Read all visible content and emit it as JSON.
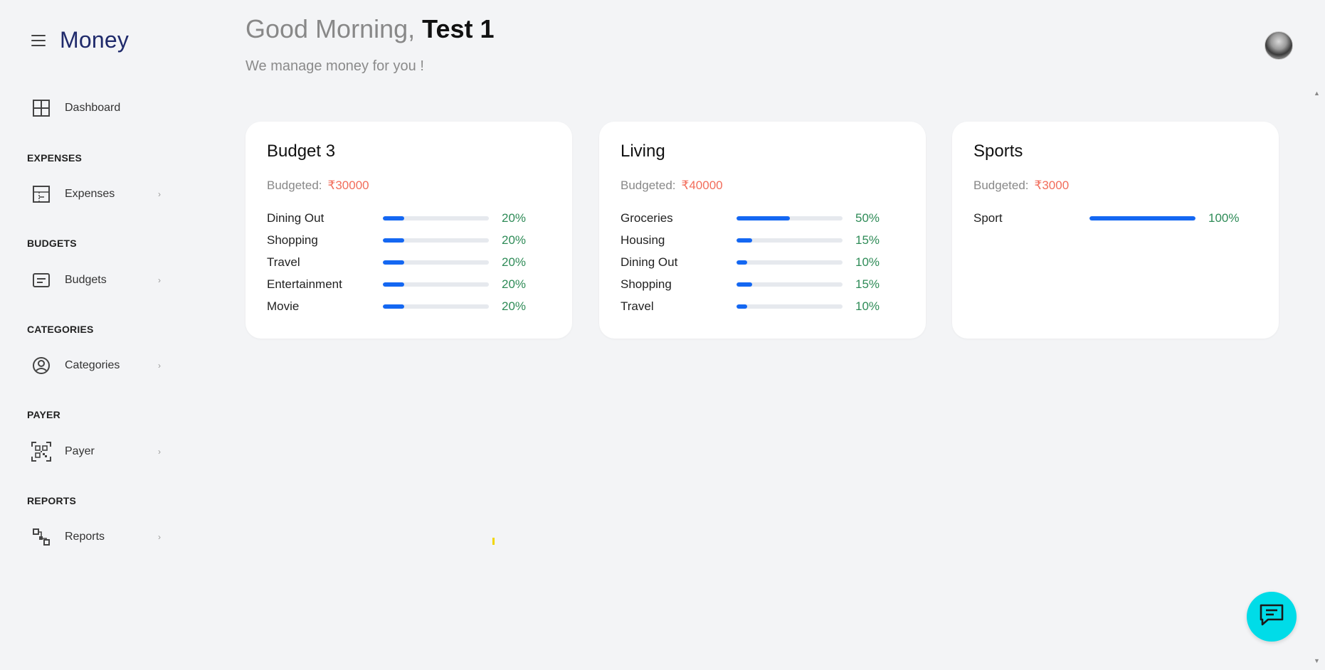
{
  "brand": {
    "title": "Money"
  },
  "nav": {
    "dashboard": "Dashboard",
    "sections": [
      {
        "heading": "EXPENSES",
        "item": "Expenses"
      },
      {
        "heading": "BUDGETS",
        "item": "Budgets"
      },
      {
        "heading": "CATEGORIES",
        "item": "Categories"
      },
      {
        "heading": "PAYER",
        "item": "Payer"
      },
      {
        "heading": "REPORTS",
        "item": "Reports"
      }
    ]
  },
  "header": {
    "greeting": "Good Morning,",
    "user": "Test 1",
    "subtitle": "We manage money for you !"
  },
  "cards": [
    {
      "title": "Budget 3",
      "budgeted_label": "Budgeted:",
      "amount": "₹30000",
      "rows": [
        {
          "name": "Dining Out",
          "pct": "20%",
          "value": 20
        },
        {
          "name": "Shopping",
          "pct": "20%",
          "value": 20
        },
        {
          "name": "Travel",
          "pct": "20%",
          "value": 20
        },
        {
          "name": "Entertainment",
          "pct": "20%",
          "value": 20
        },
        {
          "name": "Movie",
          "pct": "20%",
          "value": 20
        }
      ]
    },
    {
      "title": "Living",
      "budgeted_label": "Budgeted:",
      "amount": "₹40000",
      "rows": [
        {
          "name": "Groceries",
          "pct": "50%",
          "value": 50
        },
        {
          "name": "Housing",
          "pct": "15%",
          "value": 15
        },
        {
          "name": "Dining Out",
          "pct": "10%",
          "value": 10
        },
        {
          "name": "Shopping",
          "pct": "15%",
          "value": 15
        },
        {
          "name": "Travel",
          "pct": "10%",
          "value": 10
        }
      ]
    },
    {
      "title": "Sports",
      "budgeted_label": "Budgeted:",
      "amount": "₹3000",
      "rows": [
        {
          "name": "Sport",
          "pct": "100%",
          "value": 100
        }
      ]
    }
  ],
  "colors": {
    "brand": "#1f2a6b",
    "amount": "#f26d5b",
    "bar_fill": "#1467f2",
    "percent": "#2e8b57",
    "chat_button": "#00dce8"
  },
  "icons": {
    "menu": "hamburger-icon",
    "dashboard": "grid-icon",
    "expenses": "layout-icon",
    "budgets": "card-icon",
    "categories": "user-circle-icon",
    "payer": "qr-code-icon",
    "reports": "flow-icon",
    "chat": "chat-icon"
  }
}
